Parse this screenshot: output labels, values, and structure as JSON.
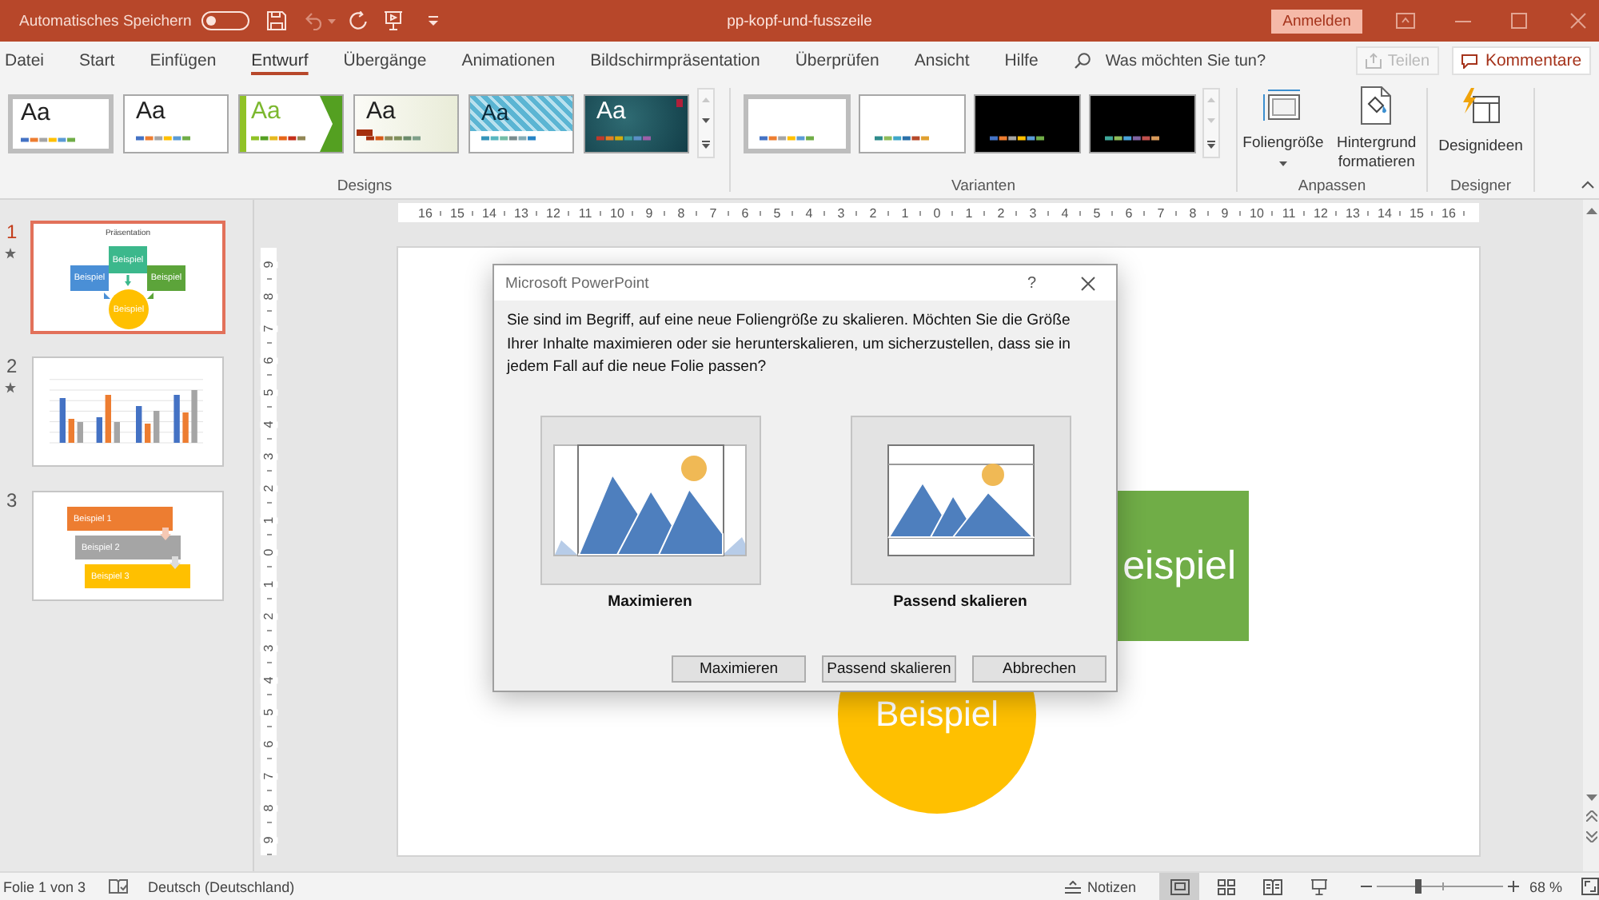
{
  "title_bar": {
    "autosave_label": "Automatisches Speichern",
    "autosave_on": false,
    "title": "pp-kopf-und-fusszeile",
    "sign_in": "Anmelden"
  },
  "ribbon_tabs": [
    {
      "label": "Datei",
      "selected": false
    },
    {
      "label": "Start",
      "selected": false
    },
    {
      "label": "Einfügen",
      "selected": false
    },
    {
      "label": "Entwurf",
      "selected": true
    },
    {
      "label": "Übergänge",
      "selected": false
    },
    {
      "label": "Animationen",
      "selected": false
    },
    {
      "label": "Bildschirmpräsentation",
      "selected": false
    },
    {
      "label": "Überprüfen",
      "selected": false
    },
    {
      "label": "Ansicht",
      "selected": false
    },
    {
      "label": "Hilfe",
      "selected": false
    }
  ],
  "search": {
    "placeholder": "Was möchten Sie tun?"
  },
  "share_button": {
    "label": "Teilen",
    "disabled": true
  },
  "comments_button": {
    "label": "Kommentare",
    "disabled": false
  },
  "ribbon": {
    "designs": {
      "label": "Designs",
      "themes": [
        {
          "label": "Aa",
          "selected": true
        },
        {
          "label": "Aa",
          "selected": false
        },
        {
          "label": "Aa",
          "selected": false
        },
        {
          "label": "Aa",
          "selected": false
        },
        {
          "label": "Aa",
          "selected": false
        },
        {
          "label": "Aa",
          "selected": false
        }
      ]
    },
    "variants": {
      "label": "Varianten",
      "items": [
        {
          "kind": "light",
          "selected": true
        },
        {
          "kind": "light",
          "selected": false
        },
        {
          "kind": "dark",
          "selected": false
        },
        {
          "kind": "dark",
          "selected": false
        }
      ]
    },
    "customize": {
      "label": "Anpassen",
      "buttons": [
        {
          "kind": "slide_size",
          "label": "Foliengröße",
          "dropdown": true
        },
        {
          "kind": "background",
          "label": "Hintergrund formatieren",
          "dropdown": false
        }
      ]
    },
    "designer": {
      "label": "Designer",
      "buttons": [
        {
          "kind": "design_ideas",
          "label": "Designideen"
        }
      ]
    }
  },
  "slides": [
    {
      "number": "1",
      "selected": true,
      "animated": true,
      "kind": "diagram",
      "title": "Präsentation",
      "labels": [
        "Beispiel",
        "Beispiel",
        "Beispiel",
        "Beispiel"
      ]
    },
    {
      "number": "2",
      "selected": false,
      "animated": true,
      "kind": "chart"
    },
    {
      "number": "3",
      "selected": false,
      "animated": false,
      "kind": "steps",
      "labels": [
        "Beispiel 1",
        "Beispiel 2",
        "Beispiel 3"
      ]
    }
  ],
  "rulers": {
    "horizontal": [
      "16",
      "15",
      "14",
      "13",
      "12",
      "11",
      "10",
      "9",
      "8",
      "7",
      "6",
      "5",
      "4",
      "3",
      "2",
      "1",
      "0",
      "1",
      "2",
      "3",
      "4",
      "5",
      "6",
      "7",
      "8",
      "9",
      "10",
      "11",
      "12",
      "13",
      "14",
      "15",
      "16"
    ],
    "vertical": [
      "9",
      "8",
      "7",
      "6",
      "5",
      "4",
      "3",
      "2",
      "1",
      "0",
      "1",
      "2",
      "3",
      "4",
      "5",
      "6",
      "7",
      "8",
      "9"
    ]
  },
  "slide": {
    "shapes": [
      {
        "kind": "box",
        "text": "eispiel",
        "color": "#70ad47"
      },
      {
        "kind": "circle",
        "text": "Beispiel",
        "color": "#ffc000"
      }
    ]
  },
  "dialog": {
    "title": "Microsoft PowerPoint",
    "help": "?",
    "message": "Sie sind im Begriff, auf eine neue Foliengröße zu skalieren. Möchten Sie die Größe Ihrer Inhalte maximieren oder sie herunterskalieren, um sicherzustellen, dass sie in jedem Fall auf die neue Folie passen?",
    "options": [
      {
        "kind": "maximize",
        "label": "Maximieren"
      },
      {
        "kind": "fit",
        "label": "Passend skalieren"
      }
    ],
    "buttons": [
      "Maximieren",
      "Passend skalieren",
      "Abbrechen"
    ]
  },
  "status_bar": {
    "slide_info": "Folie 1 von 3",
    "language": "Deutsch (Deutschland)",
    "notes": "Notizen",
    "views": [
      {
        "kind": "normal",
        "selected": true
      },
      {
        "kind": "sorter",
        "selected": false
      },
      {
        "kind": "reading",
        "selected": false
      },
      {
        "kind": "slideshow",
        "selected": false
      }
    ],
    "zoom": {
      "level": 0.32,
      "value": "68 %"
    }
  }
}
